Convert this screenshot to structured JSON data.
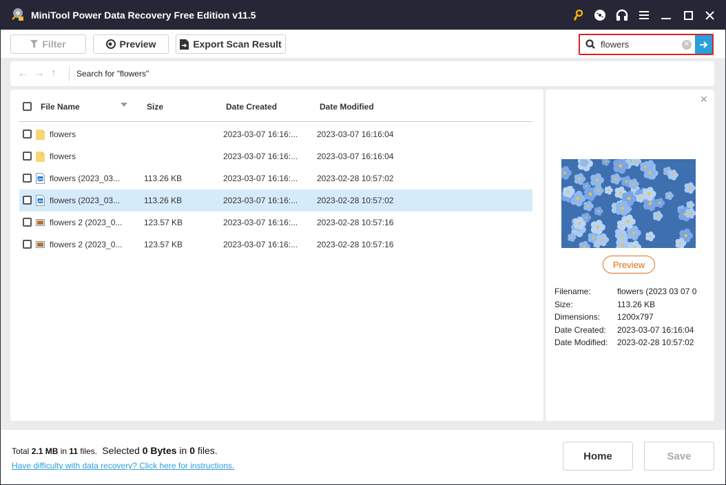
{
  "window": {
    "title": "MiniTool Power Data Recovery Free Edition v11.5",
    "controls": [
      "key-icon",
      "disc-icon",
      "headphones-icon",
      "menu-icon",
      "minimize-icon",
      "maximize-icon",
      "close-icon"
    ],
    "accent_color": "#2b9fdc",
    "key_color": "#f0b400"
  },
  "toolbar": {
    "filter_label": "Filter",
    "preview_label": "Preview",
    "export_label": "Export Scan Result",
    "search_value": "flowers",
    "search_placeholder": ""
  },
  "nav": {
    "path": "Search for  \"flowers\""
  },
  "table": {
    "headers": {
      "name": "File Name",
      "size": "Size",
      "created": "Date Created",
      "modified": "Date Modified"
    },
    "rows": [
      {
        "type": "folder",
        "name": "flowers",
        "size": "",
        "created": "2023-03-07 16:16:...",
        "modified": "2023-03-07 16:16:04",
        "selected": false
      },
      {
        "type": "folder",
        "name": "flowers",
        "size": "",
        "created": "2023-03-07 16:16:...",
        "modified": "2023-03-07 16:16:04",
        "selected": false
      },
      {
        "type": "image",
        "name": "flowers (2023_03...",
        "size": "113.26 KB",
        "created": "2023-03-07 16:16:...",
        "modified": "2023-02-28 10:57:02",
        "selected": false
      },
      {
        "type": "image",
        "name": "flowers (2023_03...",
        "size": "113.26 KB",
        "created": "2023-03-07 16:16:...",
        "modified": "2023-02-28 10:57:02",
        "selected": true
      },
      {
        "type": "photo",
        "name": "flowers 2 (2023_0...",
        "size": "123.57 KB",
        "created": "2023-03-07 16:16:...",
        "modified": "2023-02-28 10:57:16",
        "selected": false
      },
      {
        "type": "photo",
        "name": "flowers 2 (2023_0...",
        "size": "123.57 KB",
        "created": "2023-03-07 16:16:...",
        "modified": "2023-02-28 10:57:16",
        "selected": false
      }
    ]
  },
  "preview": {
    "button_label": "Preview",
    "labels": {
      "filename": "Filename:",
      "size": "Size:",
      "dimensions": "Dimensions:",
      "created": "Date Created:",
      "modified": "Date Modified:"
    },
    "values": {
      "filename": "flowers (2023  03  07 0",
      "size": "113.26 KB",
      "dimensions": "1200x797",
      "created": "2023-03-07 16:16:04",
      "modified": "2023-02-28 10:57:02"
    }
  },
  "footer": {
    "total_prefix": "Total ",
    "total_size": "2.1 MB",
    "total_mid": " in ",
    "total_files": "11",
    "total_suffix": " files.",
    "selected_prefix": "Selected ",
    "selected_size": "0 Bytes",
    "selected_mid": " in ",
    "selected_files": "0",
    "selected_suffix": " files.",
    "help_link": "Have difficulty with data recovery? Click here for instructions.",
    "home_label": "Home",
    "save_label": "Save"
  }
}
